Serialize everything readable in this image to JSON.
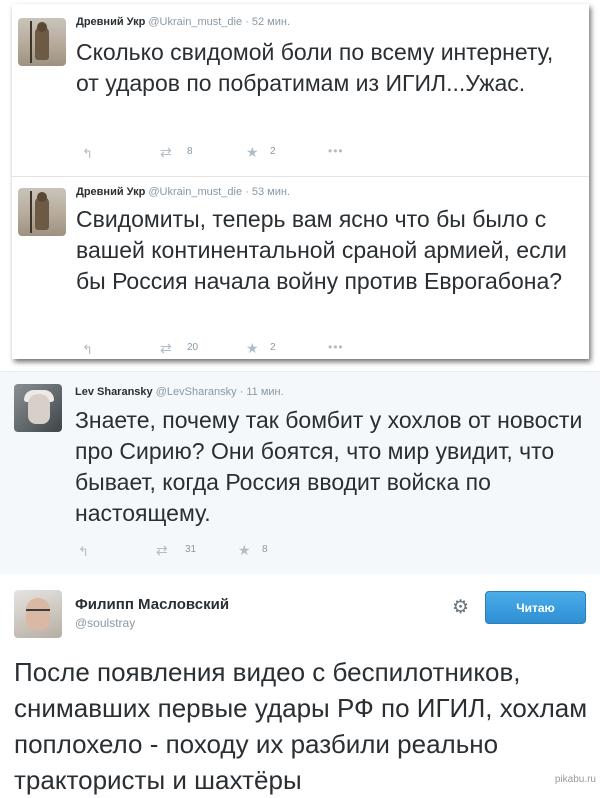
{
  "tweets": [
    {
      "name": "Древний Укр",
      "handle": "@Ukrain_must_die",
      "time": "· 52 мин.",
      "text": "Сколько свидомой боли по всему интернету, от ударов по побратимам из ИГИЛ...Ужас.",
      "retweets": "8",
      "favorites": "2"
    },
    {
      "name": "Древний Укр",
      "handle": "@Ukrain_must_die",
      "time": "· 53 мин.",
      "text": "Свидомиты, теперь вам ясно что бы было с вашей континентальной сраной армией, если бы Россия начала войну против Еврогабона?",
      "retweets": "20",
      "favorites": "2"
    },
    {
      "name": "Lev Sharansky",
      "handle": "@LevSharansky",
      "time": "· 11 мин.",
      "text": "Знаете, почему так бомбит у хохлов от новости про Сирию? Они боятся, что мир увидит, что бывает, когда Россия вводит войска по настоящему.",
      "retweets": "31",
      "favorites": "8"
    }
  ],
  "profile_tweet": {
    "name": "Филипп Масловский",
    "handle": "@soulstray",
    "follow_label": "Читаю",
    "text": "После появления видео с беспилотников, снимавших первые удары РФ по ИГИЛ, хохлам поплохело - походу их разбили реально трактористы и шахтёры"
  },
  "icons": {
    "reply": "reply-icon",
    "retweet": "retweet-icon",
    "favorite": "star-icon",
    "more": "more-icon",
    "settings": "gear-icon"
  },
  "glyphs": {
    "reply": "↰",
    "retweet": "⇄",
    "favorite": "★",
    "more": "•••",
    "gear": "⚙"
  },
  "colors": {
    "follow_button": "#2f8fd3",
    "meta_text": "#8899a6",
    "body_text": "#292f33"
  },
  "watermark": "pikabu.ru"
}
